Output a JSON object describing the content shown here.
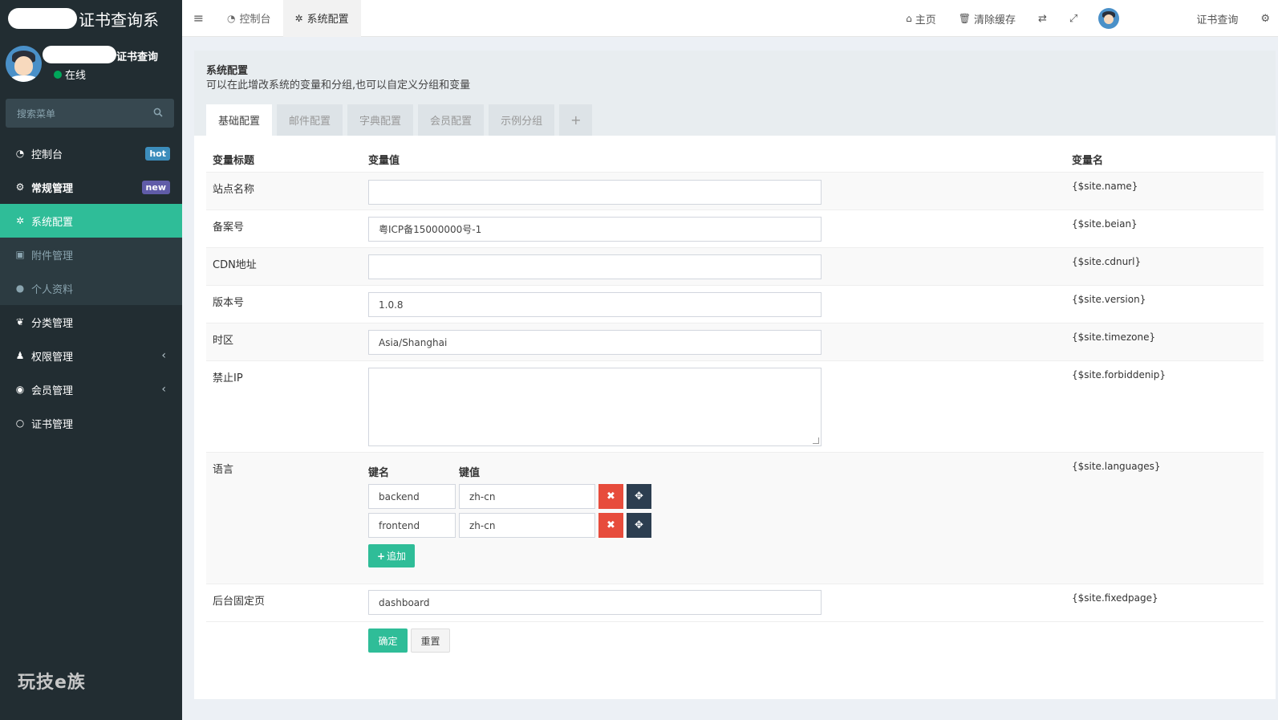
{
  "app": {
    "logo_text": "证书查询系",
    "username_suffix": "证书查询",
    "status": "在线",
    "footer_brand": "玩技e族"
  },
  "sidebar": {
    "search_placeholder": "搜索菜单",
    "items": [
      {
        "label": "控制台",
        "icon": "dashboard-icon",
        "badge": "hot"
      },
      {
        "label": "常规管理",
        "icon": "cogs-icon",
        "badge": "new"
      },
      {
        "label": "系统配置",
        "icon": "gear-icon"
      },
      {
        "label": "附件管理",
        "icon": "file-image-icon"
      },
      {
        "label": "个人资料",
        "icon": "user-icon"
      },
      {
        "label": "分类管理",
        "icon": "leaf-icon"
      },
      {
        "label": "权限管理",
        "icon": "group-icon"
      },
      {
        "label": "会员管理",
        "icon": "user-circle-icon"
      },
      {
        "label": "证书管理",
        "icon": "circle-icon"
      }
    ]
  },
  "topbar": {
    "tabs": [
      {
        "label": "控制台"
      },
      {
        "label": "系统配置"
      }
    ],
    "home": "主页",
    "clear_cache": "清除缓存",
    "user_link": "证书查询"
  },
  "page": {
    "title": "系统配置",
    "description": "可以在此增改系统的变量和分组,也可以自定义分组和变量",
    "tabs": [
      "基础配置",
      "邮件配置",
      "字典配置",
      "会员配置",
      "示例分组"
    ],
    "add_tab": "+"
  },
  "table": {
    "headers": {
      "title": "变量标题",
      "value": "变量值",
      "name": "变量名"
    },
    "rows": {
      "site_name": {
        "title": "站点名称",
        "value": "",
        "name": "{$site.name}"
      },
      "beian": {
        "title": "备案号",
        "value": "粤ICP备15000000号-1",
        "name": "{$site.beian}"
      },
      "cdnurl": {
        "title": "CDN地址",
        "value": "",
        "name": "{$site.cdnurl}"
      },
      "version": {
        "title": "版本号",
        "value": "1.0.8",
        "name": "{$site.version}"
      },
      "timezone": {
        "title": "时区",
        "value": "Asia/Shanghai",
        "name": "{$site.timezone}"
      },
      "forbiddenip": {
        "title": "禁止IP",
        "value": "",
        "name": "{$site.forbiddenip}"
      },
      "languages": {
        "title": "语言",
        "name": "{$site.languages}",
        "key_header": "键名",
        "value_header": "键值",
        "pairs": [
          {
            "key": "backend",
            "value": "zh-cn"
          },
          {
            "key": "frontend",
            "value": "zh-cn"
          }
        ],
        "add_label": "追加"
      },
      "fixedpage": {
        "title": "后台固定页",
        "value": "dashboard",
        "name": "{$site.fixedpage}"
      }
    }
  },
  "actions": {
    "submit": "确定",
    "reset": "重置"
  },
  "colors": {
    "sidebar_bg": "#222d32",
    "accent": "#2fbd98",
    "danger": "#e74c3c",
    "dark": "#2c3e50"
  }
}
